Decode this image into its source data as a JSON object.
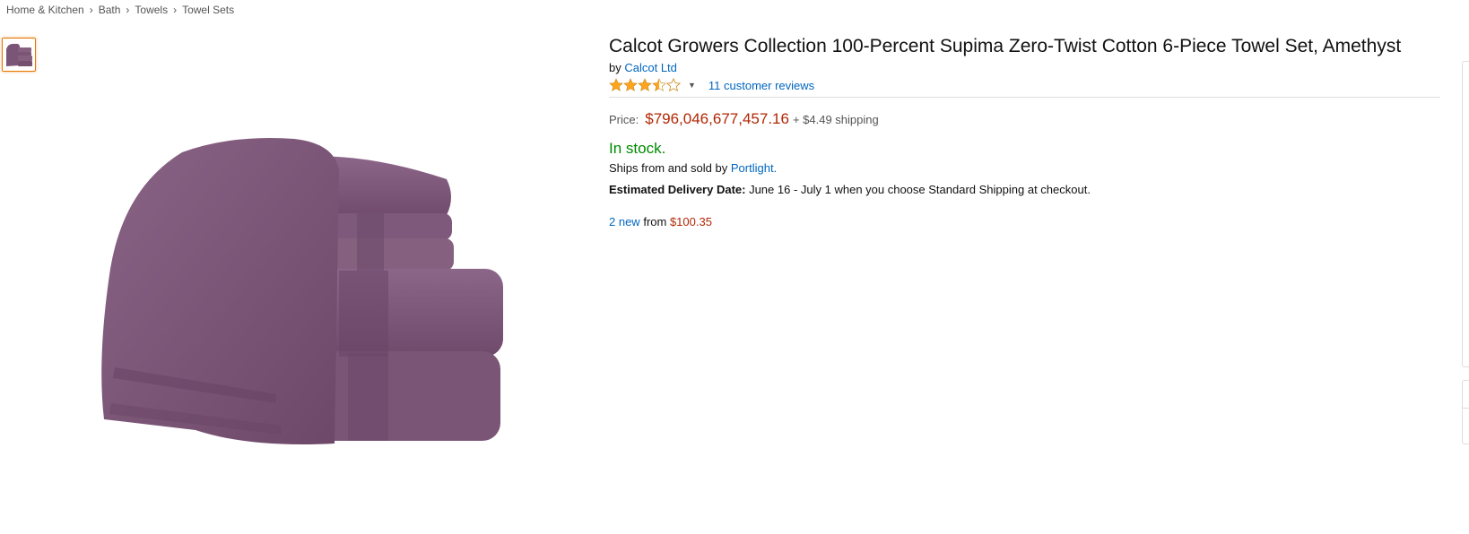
{
  "breadcrumb": [
    "Home & Kitchen",
    "Bath",
    "Towels",
    "Towel Sets"
  ],
  "breadcrumb_separator": "›",
  "product": {
    "title": "Calcot Growers Collection 100-Percent Supima Zero-Twist Cotton 6-Piece Towel Set, Amethyst",
    "by_label": "by",
    "brand": "Calcot Ltd",
    "rating": 3.5,
    "rating_max": 5,
    "reviews_label": "11 customer reviews",
    "price_label": "Price:",
    "price": "$796,046,677,457.16",
    "shipping": "+ $4.49 shipping",
    "stock": "In stock.",
    "ships_prefix": "Ships from and sold by",
    "seller": "Portlight.",
    "delivery_label": "Estimated Delivery Date:",
    "delivery_text": "June 16 - July 1 when you choose Standard Shipping at checkout.",
    "offers_link": "2 new",
    "offers_from": "from",
    "offers_price": "$100.35"
  },
  "icons": {
    "rating_caret": "caret-down-icon"
  },
  "colors": {
    "link": "#0066c0",
    "price": "#b12704",
    "in_stock": "#008a00",
    "star": "#ffa41c",
    "towel": "#7b5578"
  }
}
